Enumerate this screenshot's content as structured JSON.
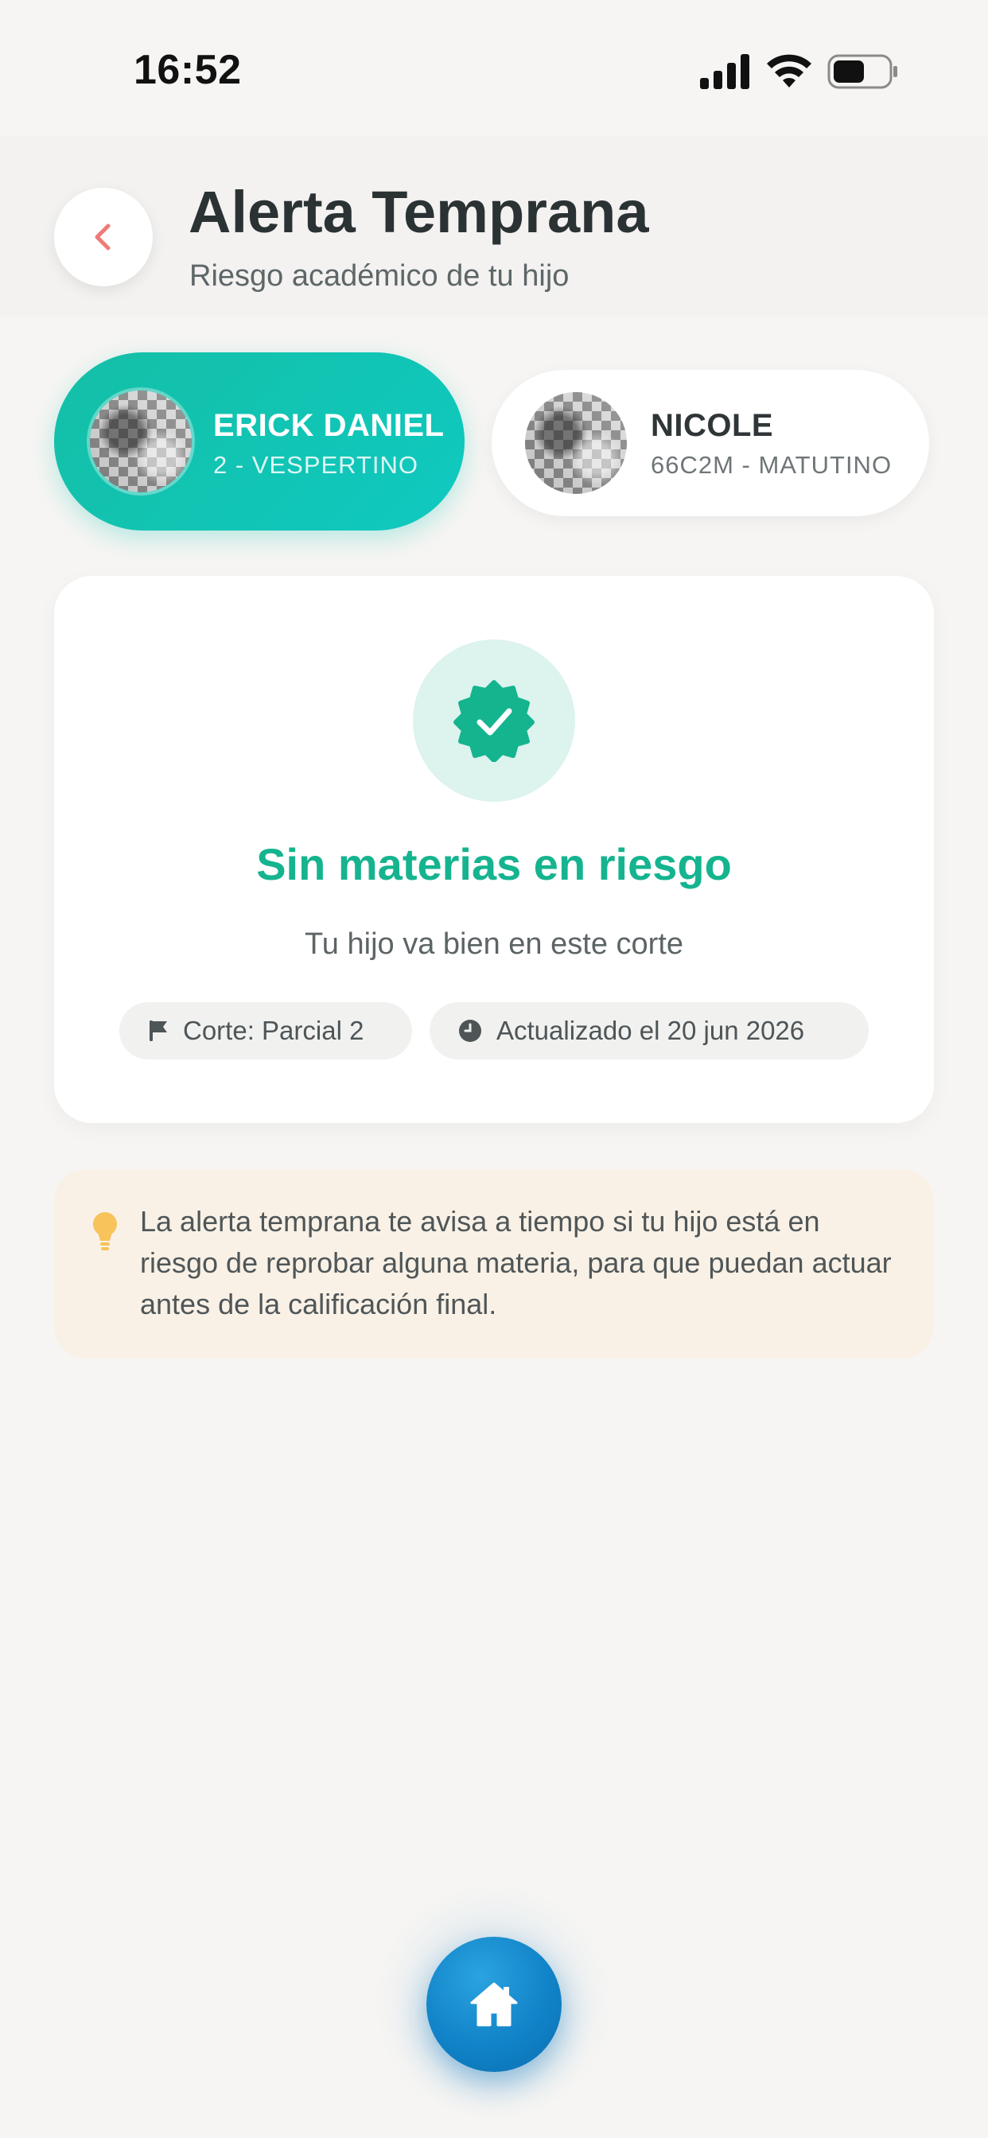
{
  "status_bar": {
    "time": "16:52",
    "icons": [
      "cellular-signal-icon",
      "wifi-icon",
      "battery-icon"
    ]
  },
  "header": {
    "back_icon": "chevron-left-icon",
    "title": "Alerta Temprana",
    "subtitle": "Riesgo académico de tu hijo"
  },
  "students": [
    {
      "name": "ERICK DANIEL",
      "group": "2 - VESPERTINO",
      "selected": true
    },
    {
      "name": "NICOLE",
      "group": "66C2M - MATUTINO",
      "selected": false
    }
  ],
  "status_card": {
    "icon": "verified-check-badge-icon",
    "title": "Sin materias en riesgo",
    "description": "Tu hijo va bien en este corte",
    "pills": {
      "corte": {
        "icon": "flag-icon",
        "label": "Corte: Parcial 2"
      },
      "updated": {
        "icon": "clock-icon",
        "label": "Actualizado el 20 jun 2026"
      }
    }
  },
  "info": {
    "icon": "lightbulb-icon",
    "text": "La alerta temprana te avisa a tiempo si tu hijo está en riesgo de reprobar alguna materia, para que puedan actuar antes de la calificación final."
  },
  "nav": {
    "home_icon": "home-icon"
  },
  "colors": {
    "accent_teal": "#14bfa6",
    "success_green": "#15b48f",
    "back_chevron": "#f07a78",
    "home_blue": "#1183c8",
    "info_bg": "#f9f1e6",
    "bulb_yellow": "#f7c35a"
  }
}
